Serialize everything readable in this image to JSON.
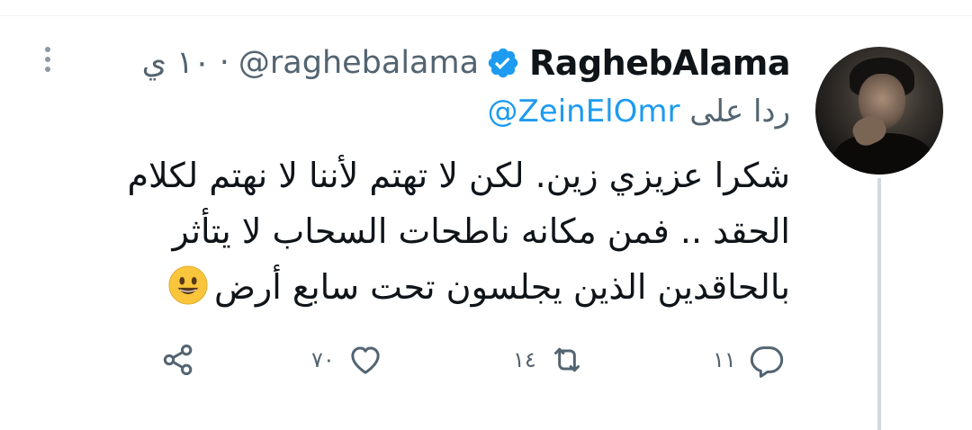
{
  "tweet": {
    "display_name": "RaghebAlama",
    "handle": "@raghebalama",
    "separator": "·",
    "time": "١٠ ي",
    "reply_prefix": "ردا على",
    "reply_mention": "@ZeinElOmr",
    "text": "شكرا عزيزي زين. لكن لا تهتم لأننا لا نهتم لكلام الحقد .. فمن مكانه ناطحات السحاب لا يتأثر بالحاقدين الذين يجلسون تحت سابع أرض"
  },
  "actions": {
    "reply_count": "١١",
    "retweet_count": "١٤",
    "like_count": "٧٠"
  },
  "icons": {
    "more": "more-dots-icon",
    "verified": "verified-badge-icon",
    "reply": "reply-icon",
    "retweet": "retweet-icon",
    "like": "heart-icon",
    "share": "share-icon",
    "emoji": "grinning-face-emoji"
  },
  "colors": {
    "verified": "#1d9bf0",
    "mention": "#1d9bf0",
    "secondary_text": "#536471",
    "primary_text": "#0f1419"
  }
}
